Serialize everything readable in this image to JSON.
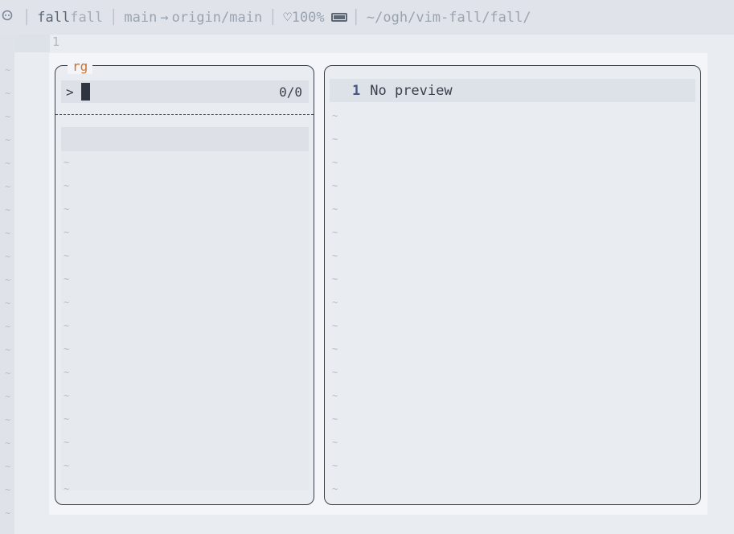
{
  "tabline": {
    "buffer_active": "fall",
    "buffer_inactive": "fall",
    "branch": "main",
    "arrow": "→",
    "remote": "origin/main",
    "heart": "♡",
    "battery_percent": "100%",
    "path": "~/ogh/vim-fall/fall/"
  },
  "editor": {
    "line_number": "1"
  },
  "picker": {
    "source_name": "rg",
    "prompt_symbol": ">",
    "query": "",
    "count": "0/0"
  },
  "preview": {
    "line_number": "1",
    "text": "No preview"
  },
  "filler": "~",
  "icons": [
    "octocat-icon",
    "heart-icon",
    "battery-icon"
  ]
}
